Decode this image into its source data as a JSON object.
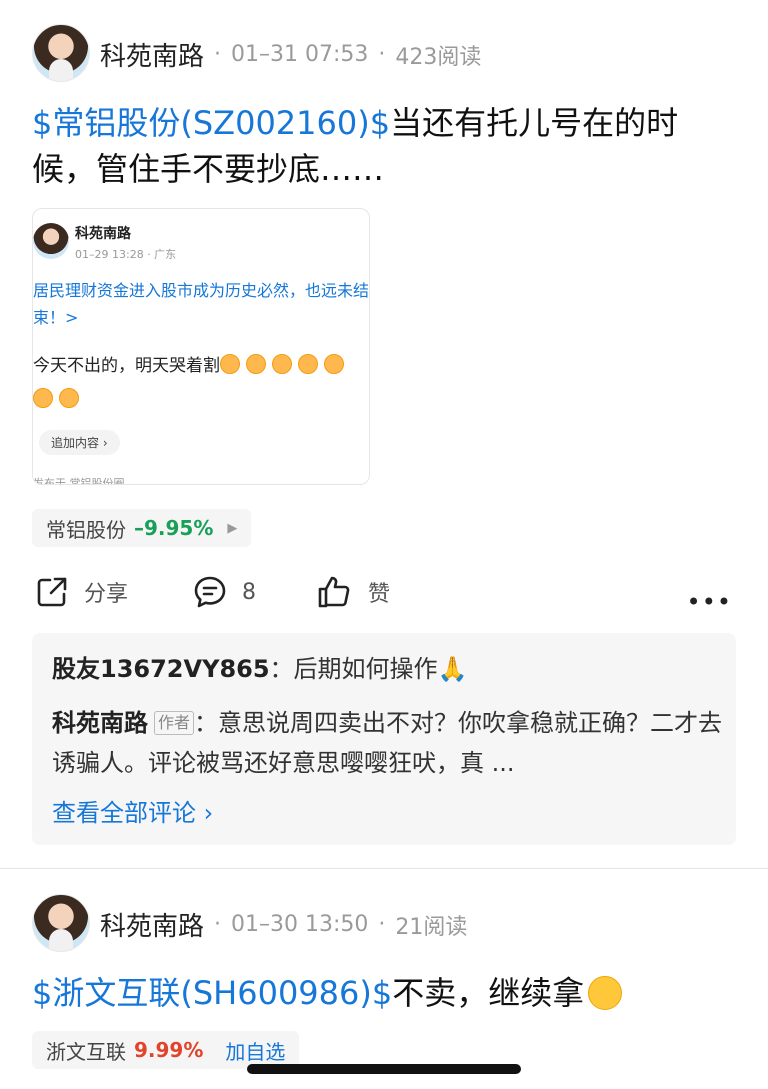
{
  "posts": [
    {
      "author": "科苑南路",
      "time": "01–31 07:53",
      "reads": "423阅读",
      "stock_link": "$常铝股份(SZ002160)$",
      "text": "当还有托儿号在的时候，管住手不要抄底……",
      "quoted": {
        "author": "科苑南路",
        "time": "01–29 13:28 · 广东",
        "link_text": "居民理财资金进入股市成为历史必然，也远未结束！>",
        "body": "今天不出的，明天哭着割",
        "add_btn": "追加内容 ›",
        "footer": "发布于 常铝股份圈"
      },
      "stock_tag": {
        "name": "常铝股份",
        "change": "–9.95%",
        "arrow": "▶"
      },
      "actions": {
        "share": "分享",
        "comments": "8",
        "like": "赞",
        "more": "•••"
      },
      "comments": [
        {
          "user": "股友13672VY865",
          "sep": "：",
          "text": "后期如何操作🙏"
        },
        {
          "user": "科苑南路",
          "role": "作者",
          "sep": "：",
          "text": "意思说周四卖出不对？你吹拿稳就正确？二才去诱骗人。评论被骂还好意思嘤嘤狂吠，真 ..."
        }
      ],
      "view_all": "查看全部评论 ›"
    },
    {
      "author": "科苑南路",
      "time": "01–30 13:50",
      "reads": "21阅读",
      "stock_link": "$浙文互联(SH600986)$",
      "text": "不卖，继续拿",
      "stock_tag": {
        "name": "浙文互联",
        "change": "9.99%",
        "add": "加自选"
      }
    }
  ],
  "colors": {
    "link": "#1677d8",
    "down": "#18a058",
    "up": "#e0452b"
  }
}
